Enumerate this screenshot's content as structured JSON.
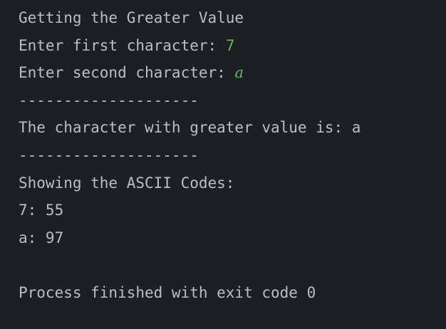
{
  "console": {
    "line1": "Getting the Greater Value",
    "line2_prompt": "Enter first character: ",
    "line2_input": "7",
    "line3_prompt": "Enter second character: ",
    "line3_input": "a",
    "separator1": "--------------------",
    "result": "The character with greater value is: a",
    "separator2": "--------------------",
    "ascii_header": "Showing the ASCII Codes:",
    "ascii_1": "7: 55",
    "ascii_2": "a: 97",
    "blank": "",
    "exit_message": "Process finished with exit code 0"
  },
  "colors": {
    "background": "#1e1f22",
    "text": "#bcbec4",
    "user_input": "#5fb865"
  }
}
